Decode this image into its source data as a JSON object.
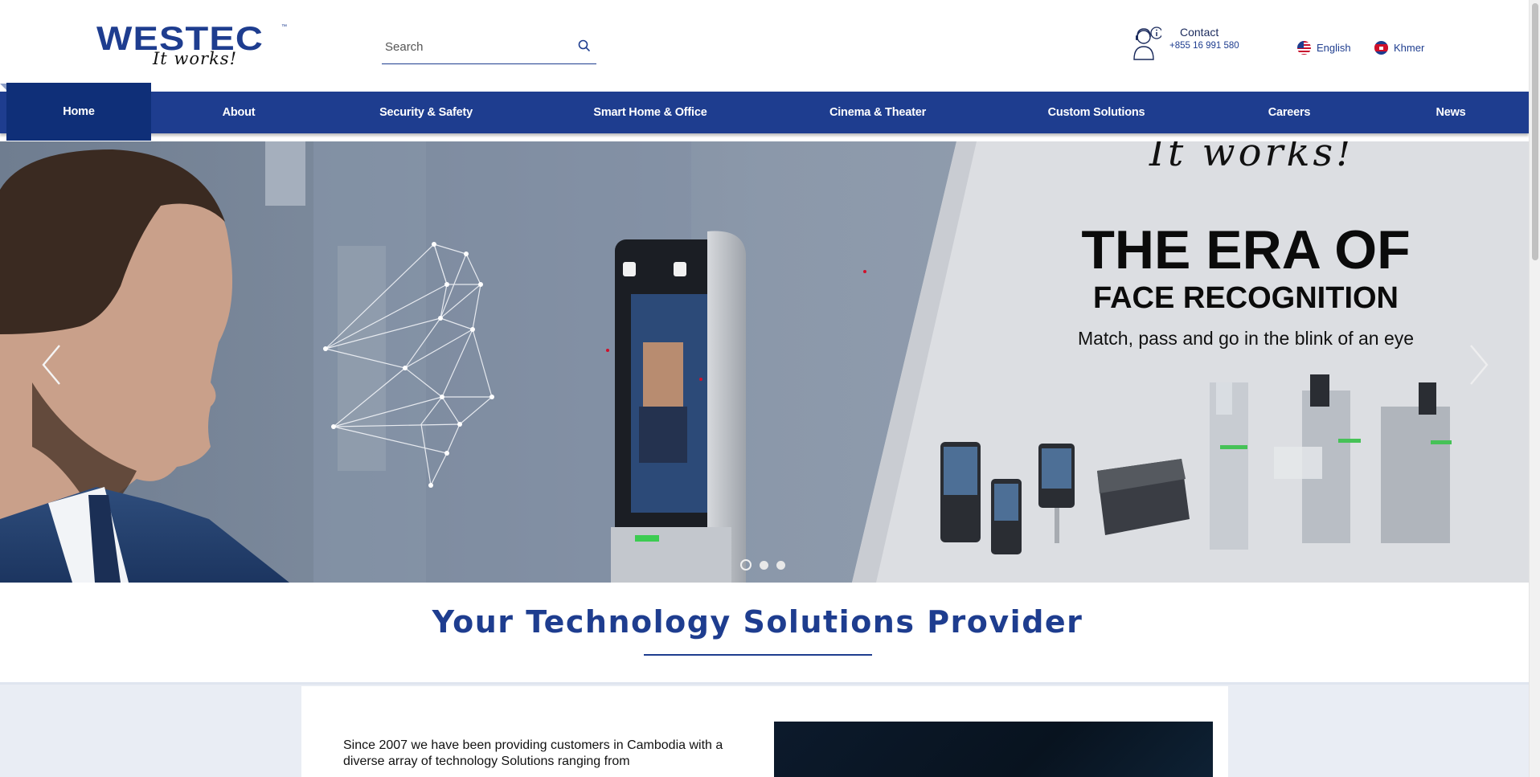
{
  "header": {
    "logo": {
      "brand": "WESTEC",
      "tagline": "It works!",
      "tm": "™"
    },
    "search": {
      "placeholder": "Search"
    },
    "contact": {
      "title": "Contact",
      "phone": "+855 16 991 580"
    },
    "languages": [
      {
        "label": "English",
        "flag": "us-flag-icon"
      },
      {
        "label": "Khmer",
        "flag": "cambodia-flag-icon"
      }
    ]
  },
  "nav": {
    "items": [
      {
        "label": "Home",
        "active": true
      },
      {
        "label": "About"
      },
      {
        "label": "Security & Safety"
      },
      {
        "label": "Smart Home & Office"
      },
      {
        "label": "Cinema & Theater"
      },
      {
        "label": "Custom Solutions"
      },
      {
        "label": "Careers"
      },
      {
        "label": "News"
      }
    ]
  },
  "hero": {
    "script": "It works!",
    "headline": "THE ERA OF",
    "subheadline": "FACE RECOGNITION",
    "tagline": "Match, pass and go in the blink of an eye",
    "slides": 3,
    "active_slide": 1
  },
  "section": {
    "heading": "Your Technology Solutions Provider",
    "intro": "Since 2007 we have been providing customers in Cambodia with a diverse array of technology Solutions ranging from"
  },
  "colors": {
    "brand": "#1e3d8f",
    "nav_active": "#0f2f78",
    "band": "#e9edf4"
  }
}
